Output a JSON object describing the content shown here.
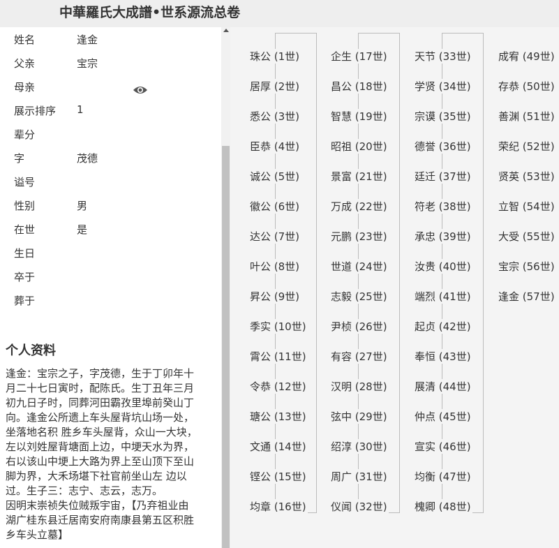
{
  "header": {
    "title": "中華羅氏大成譜•世系源流总卷"
  },
  "person": {
    "fields": [
      {
        "label": "姓名",
        "value": "逢金"
      },
      {
        "label": "父亲",
        "value": "宝宗"
      },
      {
        "label": "母亲",
        "value": ""
      },
      {
        "label": "展示排序",
        "value": "1"
      },
      {
        "label": "辈分",
        "value": ""
      },
      {
        "label": "字",
        "value": "茂德"
      },
      {
        "label": "谥号",
        "value": ""
      },
      {
        "label": "性别",
        "value": "男"
      },
      {
        "label": "在世",
        "value": "是"
      },
      {
        "label": "生日",
        "value": ""
      },
      {
        "label": "卒于",
        "value": ""
      },
      {
        "label": "葬于",
        "value": ""
      }
    ]
  },
  "profile": {
    "title": "个人资料",
    "bio_lines": [
      "逢金：宝宗之子，字茂德，生于丁卯年十",
      "月二十七日寅时，配陈氏。生丁丑年三月",
      "初九日子时，同葬河田霸孜里埠前癸山丁",
      "向。逢金公所遗上车头屋背坑山场一处，",
      "坐落地名积 胜乡车头屋背，众山一大块，",
      "左以刘姓屋背塘面上边，中埂天水为界，",
      "右以该山中埂上大路为界上至山顶下至山",
      "脚为界，大禾场堪下社官前坐山左 边以",
      "过。生子三：志宁、志云，志万。",
      "因明末崇祯失位贼叛宇宙，【乃弃祖业由",
      "湖广桂东县迁居南安府南康县第五区积胜",
      "乡车头立墓】"
    ]
  },
  "lineage": {
    "columns": [
      [
        "珠公 (1世)",
        "居厚 (2世)",
        "悉公 (3世)",
        "臣恭 (4世)",
        "诚公 (5世)",
        "徽公 (6世)",
        "达公 (7世)",
        "叶公 (8世)",
        "昇公 (9世)",
        "季实 (10世)",
        "霄公 (11世)",
        "令恭 (12世)",
        "瑭公 (13世)",
        "文通 (14世)",
        "铿公 (15世)",
        "均章 (16世)"
      ],
      [
        "企生 (17世)",
        "昌公 (18世)",
        "智慧 (19世)",
        "昭祖 (20世)",
        "景富 (21世)",
        "万成 (22世)",
        "元鹏 (23世)",
        "世道 (24世)",
        "志毅 (25世)",
        "尹桢 (26世)",
        "有容 (27世)",
        "汉明 (28世)",
        "弦中 (29世)",
        "绍淳 (30世)",
        "周广 (31世)",
        "仪闻 (32世)"
      ],
      [
        "天节 (33世)",
        "学贤 (34世)",
        "宗谟 (35世)",
        "德誉 (36世)",
        "廷迁 (37世)",
        "符老 (38世)",
        "承忠 (39世)",
        "汝贵 (40世)",
        "端烈 (41世)",
        "起贞 (42世)",
        "奉恒 (43世)",
        "展清 (44世)",
        "仲点 (45世)",
        "宣实 (46世)",
        "均衡 (47世)",
        "槐卿 (48世)"
      ],
      [
        "成宥 (49世)",
        "存恭 (50世)",
        "善渊 (51世)",
        "荣纪 (52世)",
        "贤英 (53世)",
        "立智 (54世)",
        "大受 (55世)",
        "宝宗 (56世)",
        "逢金 (57世)"
      ]
    ]
  }
}
